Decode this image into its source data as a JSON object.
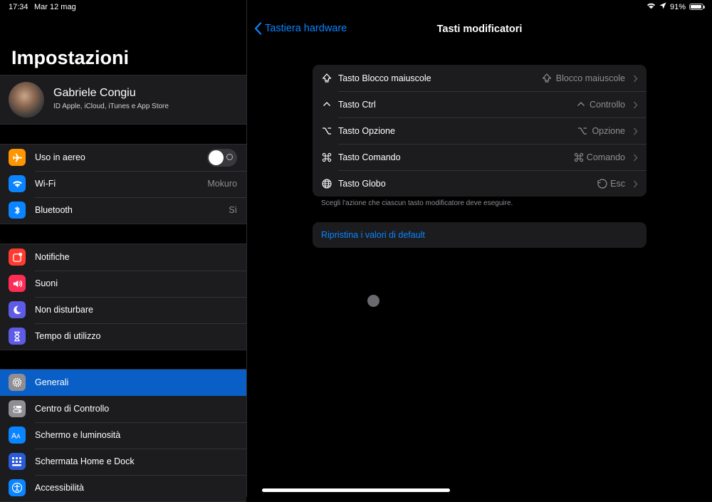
{
  "status": {
    "time": "17:34",
    "date": "Mar 12 mag",
    "battery": "91%",
    "battery_level": 0.91
  },
  "sidebar": {
    "title": "Impostazioni",
    "profile": {
      "name": "Gabriele Congiu",
      "subtitle": "ID Apple, iCloud, iTunes e App Store"
    },
    "group1": [
      {
        "label": "Uso in aereo",
        "icon": "airplane-icon",
        "color": "#ff9500",
        "toggle": false
      },
      {
        "label": "Wi-Fi",
        "icon": "wifi-icon",
        "color": "#0a84ff",
        "value": "Mokuro"
      },
      {
        "label": "Bluetooth",
        "icon": "bluetooth-icon",
        "color": "#0a84ff",
        "value": "Sì"
      }
    ],
    "group2": [
      {
        "label": "Notifiche",
        "icon": "notifications-icon",
        "color": "#ff3b30"
      },
      {
        "label": "Suoni",
        "icon": "speaker-icon",
        "color": "#ff2d55"
      },
      {
        "label": "Non disturbare",
        "icon": "moon-icon",
        "color": "#5e5ce6"
      },
      {
        "label": "Tempo di utilizzo",
        "icon": "hourglass-icon",
        "color": "#5e5ce6"
      }
    ],
    "group3": [
      {
        "label": "Generali",
        "icon": "gear-icon",
        "color": "#8e8e93",
        "selected": true
      },
      {
        "label": "Centro di Controllo",
        "icon": "switches-icon",
        "color": "#8e8e93"
      },
      {
        "label": "Schermo e luminosità",
        "icon": "text-size-icon",
        "color": "#0a84ff"
      },
      {
        "label": "Schermata Home e Dock",
        "icon": "home-grid-icon",
        "color": "#2c5bd8"
      },
      {
        "label": "Accessibilità",
        "icon": "accessibility-icon",
        "color": "#0a84ff"
      }
    ]
  },
  "navbar": {
    "back_label": "Tastiera hardware",
    "title": "Tasti modificatori"
  },
  "modifiers": [
    {
      "label": "Tasto Blocco maiuscole",
      "icon": "caps-lock-icon",
      "value": "Blocco maiuscole",
      "value_icon": "caps-lock-icon"
    },
    {
      "label": "Tasto Ctrl",
      "icon": "control-icon",
      "value": "Controllo",
      "value_icon": "control-icon"
    },
    {
      "label": "Tasto Opzione",
      "icon": "option-icon",
      "value": "Opzione",
      "value_icon": "option-icon"
    },
    {
      "label": "Tasto Comando",
      "icon": "command-icon",
      "value": "Comando",
      "value_icon": "command-icon"
    },
    {
      "label": "Tasto Globo",
      "icon": "globe-icon",
      "value": "Esc",
      "value_icon": "escape-icon"
    }
  ],
  "footnote": "Scegli l'azione che ciascun tasto modificatore deve eseguire.",
  "reset_label": "Ripristina i valori di default"
}
